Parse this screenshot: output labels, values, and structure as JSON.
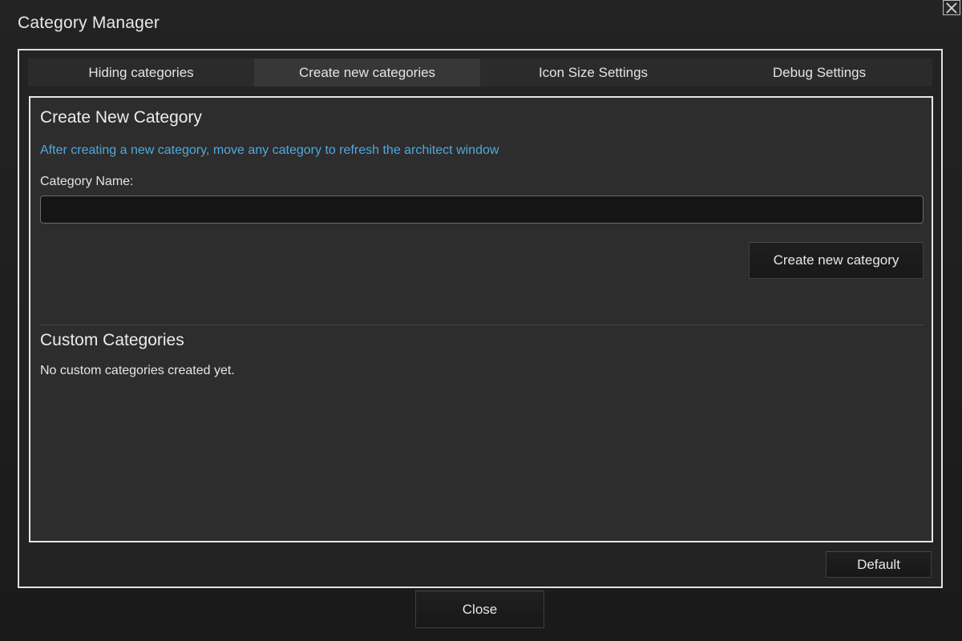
{
  "window": {
    "title": "Category Manager",
    "close_icon": "close-x-icon"
  },
  "tabs": [
    {
      "label": "Hiding categories",
      "active": false
    },
    {
      "label": "Create new categories",
      "active": true
    },
    {
      "label": "Icon Size Settings",
      "active": false
    },
    {
      "label": "Debug Settings",
      "active": false
    }
  ],
  "create_section": {
    "title": "Create New Category",
    "hint": "After creating a new category, move any category to refresh the architect window",
    "name_label": "Category Name:",
    "name_value": "",
    "name_placeholder": "",
    "create_button": "Create new category"
  },
  "custom_section": {
    "title": "Custom Categories",
    "empty_message": "No custom categories created yet."
  },
  "footer": {
    "default_button": "Default",
    "close_button": "Close"
  },
  "colors": {
    "background": "#1b1b1b",
    "panel": "#2d2d2d",
    "active_tab": "#373737",
    "hint_text": "#4fa9dc",
    "border": "#e6e6e6"
  }
}
